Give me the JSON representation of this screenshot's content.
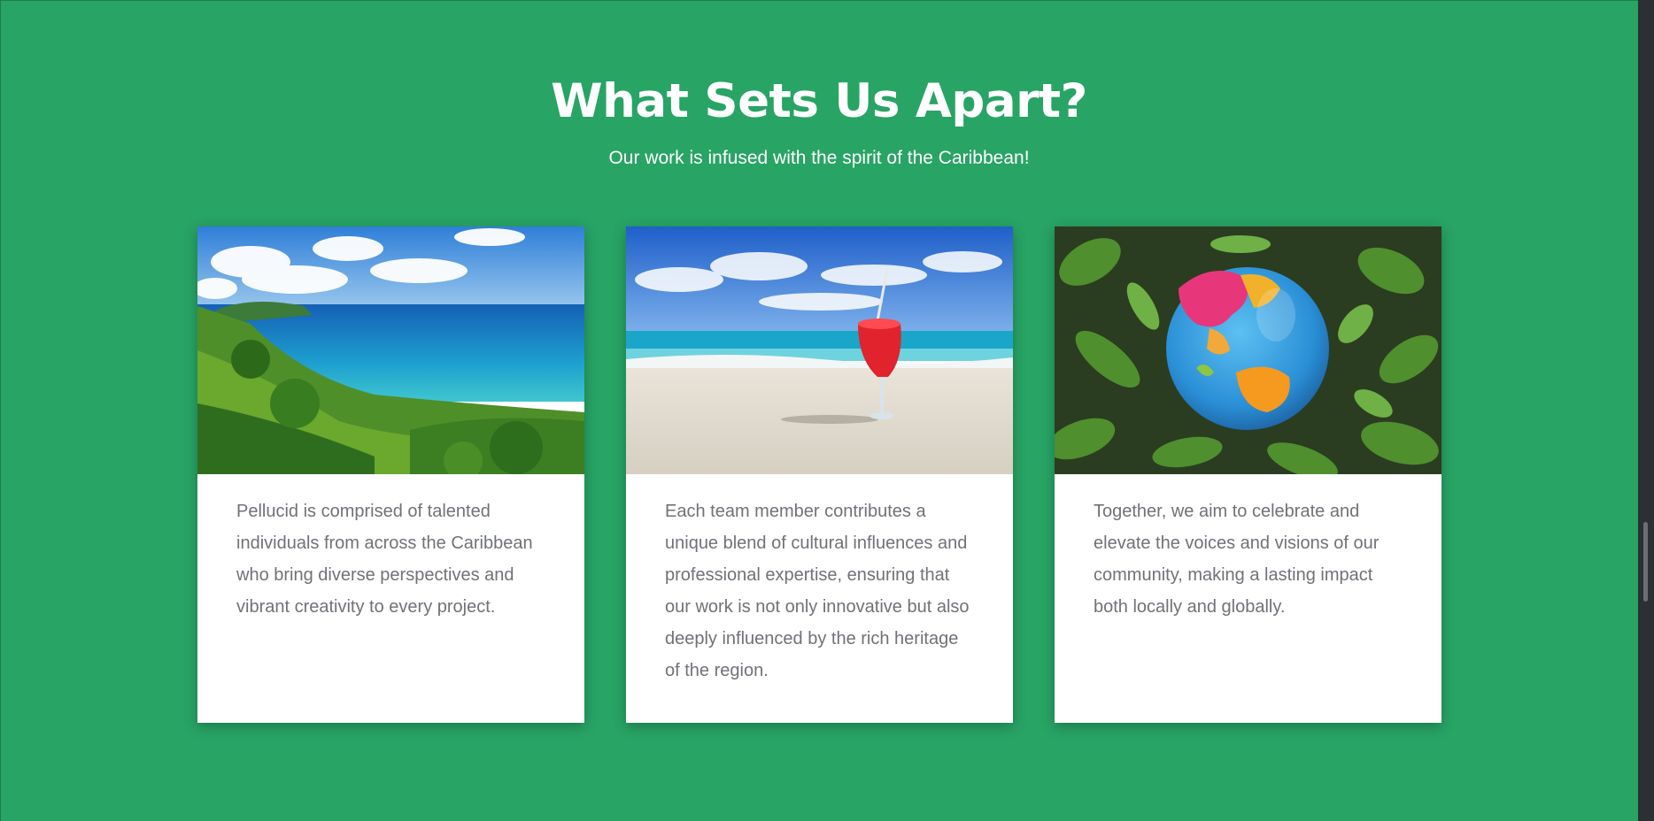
{
  "section": {
    "title": "What Sets Us Apart?",
    "subtitle": "Our work is infused with the spirit of the Caribbean!"
  },
  "cards": [
    {
      "image": "caribbean-coastline-photo",
      "text": "Pellucid is comprised of talented individuals from across the Caribbean who bring diverse perspectives and vibrant creativity to every project."
    },
    {
      "image": "beach-cocktail-photo",
      "text": "Each team member contributes a unique blend of cultural influences and professional expertise, ensuring that our work is not only innovative but also deeply influenced by the rich heritage of the region."
    },
    {
      "image": "globe-in-foliage-photo",
      "text": "Together, we aim to celebrate and elevate the voices and visions of our community, making a lasting impact both locally and globally."
    }
  ],
  "colors": {
    "background": "#28a465",
    "card": "#ffffff",
    "body_text": "#6f7277"
  }
}
